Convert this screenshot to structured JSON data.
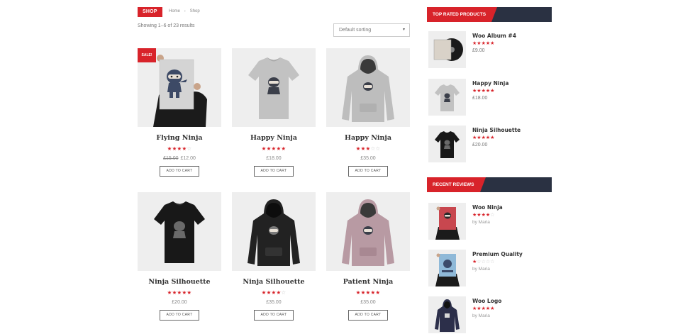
{
  "header": {
    "shop_label": "SHOP",
    "breadcrumb": [
      "Home",
      "Shop"
    ],
    "breadcrumb_sep": "›",
    "results_text": "Showing 1–6 of 23 results",
    "sort_selected": "Default sorting"
  },
  "products": [
    {
      "name": "Flying Ninja",
      "rating": 4,
      "price": "£12.00",
      "old_price": "£15.00",
      "sale": "SALE!",
      "cart": "ADD TO CART"
    },
    {
      "name": "Happy Ninja",
      "rating": 5,
      "price": "£18.00",
      "cart": "ADD TO CART"
    },
    {
      "name": "Happy Ninja",
      "rating": 3,
      "price": "£35.00",
      "cart": "ADD TO CART"
    },
    {
      "name": "Ninja Silhouette",
      "rating": 5,
      "price": "£20.00",
      "cart": "ADD TO CART"
    },
    {
      "name": "Ninja Silhouette",
      "rating": 4,
      "price": "£35.00",
      "cart": "ADD TO CART"
    },
    {
      "name": "Patient Ninja",
      "rating": 5,
      "price": "£35.00",
      "cart": "ADD TO CART"
    }
  ],
  "sidebar": {
    "top_rated": {
      "title": "TOP RATED PRODUCTS",
      "items": [
        {
          "name": "Woo Album #4",
          "rating": 5,
          "price": "£9.00"
        },
        {
          "name": "Happy Ninja",
          "rating": 5,
          "price": "£18.00"
        },
        {
          "name": "Ninja Silhouette",
          "rating": 5,
          "price": "£20.00"
        }
      ]
    },
    "recent_reviews": {
      "title": "RECENT REVIEWS",
      "items": [
        {
          "name": "Woo Ninja",
          "rating": 4,
          "by": "by Maria"
        },
        {
          "name": "Premium Quality",
          "rating": 1,
          "by": "by Maria"
        },
        {
          "name": "Woo Logo",
          "rating": 5,
          "by": "by Maria"
        }
      ]
    }
  },
  "colors": {
    "accent": "#d8232a",
    "dark": "#2a3142",
    "thumb_bg": "#eeeeee"
  },
  "icons": {
    "star_full": "★",
    "star_empty": "☆",
    "chevron": "▾"
  }
}
